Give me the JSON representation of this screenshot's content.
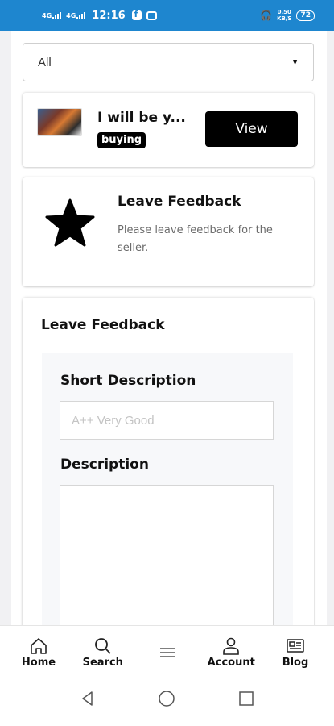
{
  "status_bar": {
    "network_1": "4G",
    "network_2": "4G",
    "time": "12:16",
    "speed_top": "0.50",
    "speed_bottom": "KB/S",
    "battery": "72"
  },
  "filter": {
    "selected": "All"
  },
  "listing": {
    "title": "I will be y...",
    "badge": "buying",
    "view_label": "View"
  },
  "feedback_prompt": {
    "title": "Leave Feedback",
    "description": "Please leave feedback for the seller."
  },
  "form": {
    "title": "Leave Feedback",
    "short_label": "Short Description",
    "short_placeholder": "A++ Very Good",
    "description_label": "Description"
  },
  "bottom_nav": {
    "items": [
      {
        "label": "Home",
        "icon": "home-icon"
      },
      {
        "label": "Search",
        "icon": "search-icon"
      },
      {
        "label": "",
        "icon": "menu-icon"
      },
      {
        "label": "Account",
        "icon": "account-icon"
      },
      {
        "label": "Blog",
        "icon": "blog-icon"
      }
    ]
  },
  "colors": {
    "status_bar": "#1e86cf",
    "button": "#000000"
  }
}
